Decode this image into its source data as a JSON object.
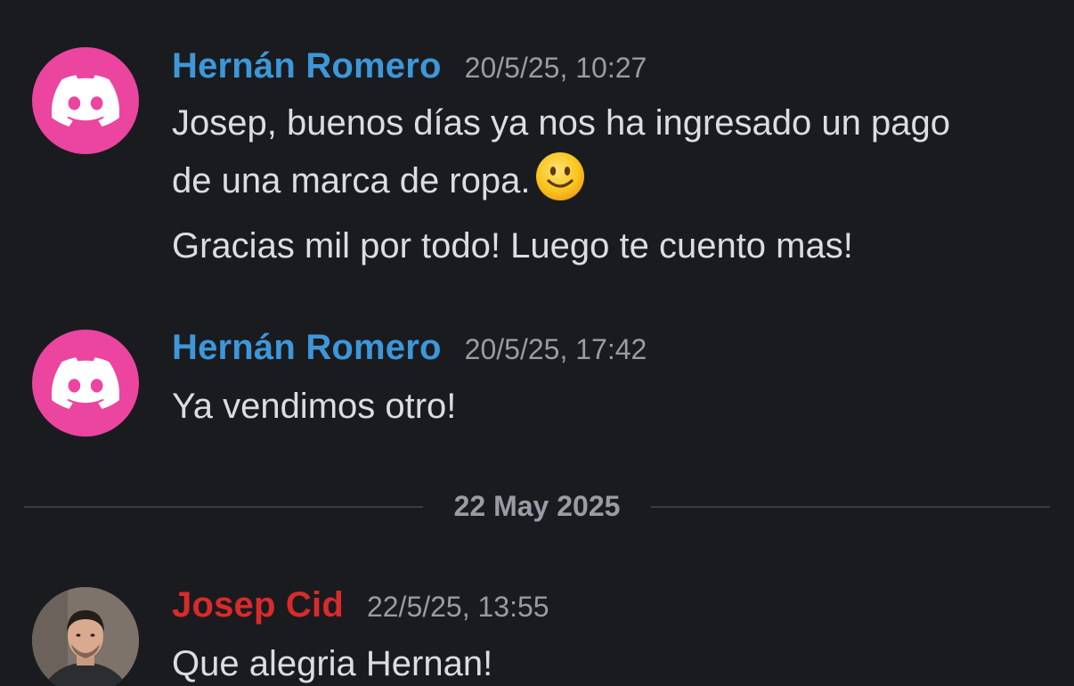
{
  "colors": {
    "background": "#1a1b1f",
    "author_blue": "#3d97d9",
    "author_red": "#d92b2b",
    "discord_avatar_bg": "#eb459f",
    "timestamp": "#9a9ba3",
    "message_text": "#dbdde1"
  },
  "messages": [
    {
      "author": "Hernán Romero",
      "author_color": "#3d97d9",
      "avatar_icon": "discord-logo-icon",
      "timestamp": "20/5/25, 10:27",
      "lines": [
        "Josep, buenos días ya nos ha ingresado un pago",
        "de una marca de ropa.",
        "Gracias mil por todo! Luego te cuento mas!"
      ],
      "emoji": "slightly-smiling-face-icon"
    },
    {
      "author": "Hernán Romero",
      "author_color": "#3d97d9",
      "avatar_icon": "discord-logo-icon",
      "timestamp": "20/5/25, 17:42",
      "lines": [
        "Ya vendimos otro!"
      ]
    },
    {
      "author": "Josep Cid",
      "author_color": "#d92b2b",
      "avatar_icon": "user-photo",
      "timestamp": "22/5/25, 13:55",
      "lines": [
        "Que alegria Hernan!"
      ]
    }
  ],
  "date_divider": {
    "label": "22 May 2025"
  }
}
